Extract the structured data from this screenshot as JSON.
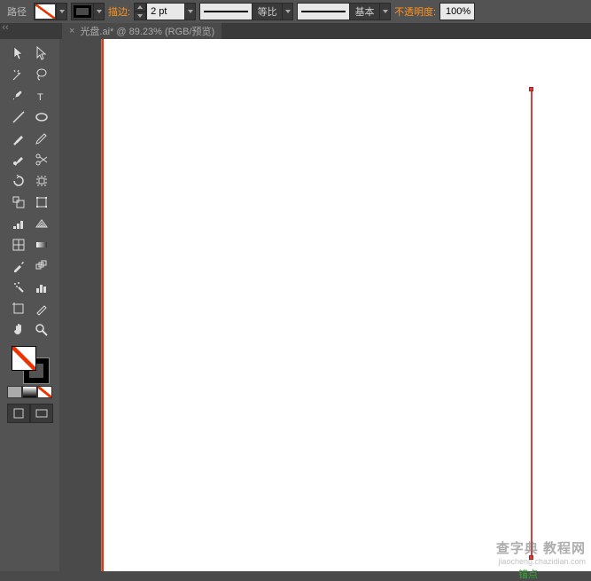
{
  "topbar": {
    "selection_label": "路径",
    "stroke_label": "描边:",
    "stroke_weight": "2 pt",
    "style1_label": "等比",
    "style2_label": "基本",
    "opacity_label": "不透明度:",
    "opacity_value": "100%"
  },
  "document": {
    "close": "×",
    "tab_title": "光盘.ai* @ 89.23% (RGB/预览)"
  },
  "canvas": {
    "anchor_label": "锚点"
  },
  "watermark": {
    "line1": "查字典 教程网",
    "line2": "jiaocheng.chazidian.com"
  },
  "tools": {
    "row1": [
      "selection",
      "direct-selection"
    ],
    "row2": [
      "magic-wand",
      "lasso"
    ],
    "row3": [
      "pen",
      "type"
    ],
    "row4": [
      "line-segment",
      "ellipse"
    ],
    "row5": [
      "paintbrush",
      "pencil"
    ],
    "row6": [
      "blob-brush",
      "scissors"
    ],
    "row7": [
      "rotate",
      "reflect"
    ],
    "row8": [
      "scale",
      "free-transform"
    ],
    "row9": [
      "column-graph",
      "perspective"
    ],
    "row10": [
      "mesh",
      "gradient"
    ],
    "row11": [
      "eyedropper",
      "blend"
    ],
    "row12": [
      "symbol-sprayer",
      "bar-graph"
    ],
    "row13": [
      "artboard",
      "slice"
    ],
    "row14": [
      "hand",
      "zoom"
    ]
  }
}
